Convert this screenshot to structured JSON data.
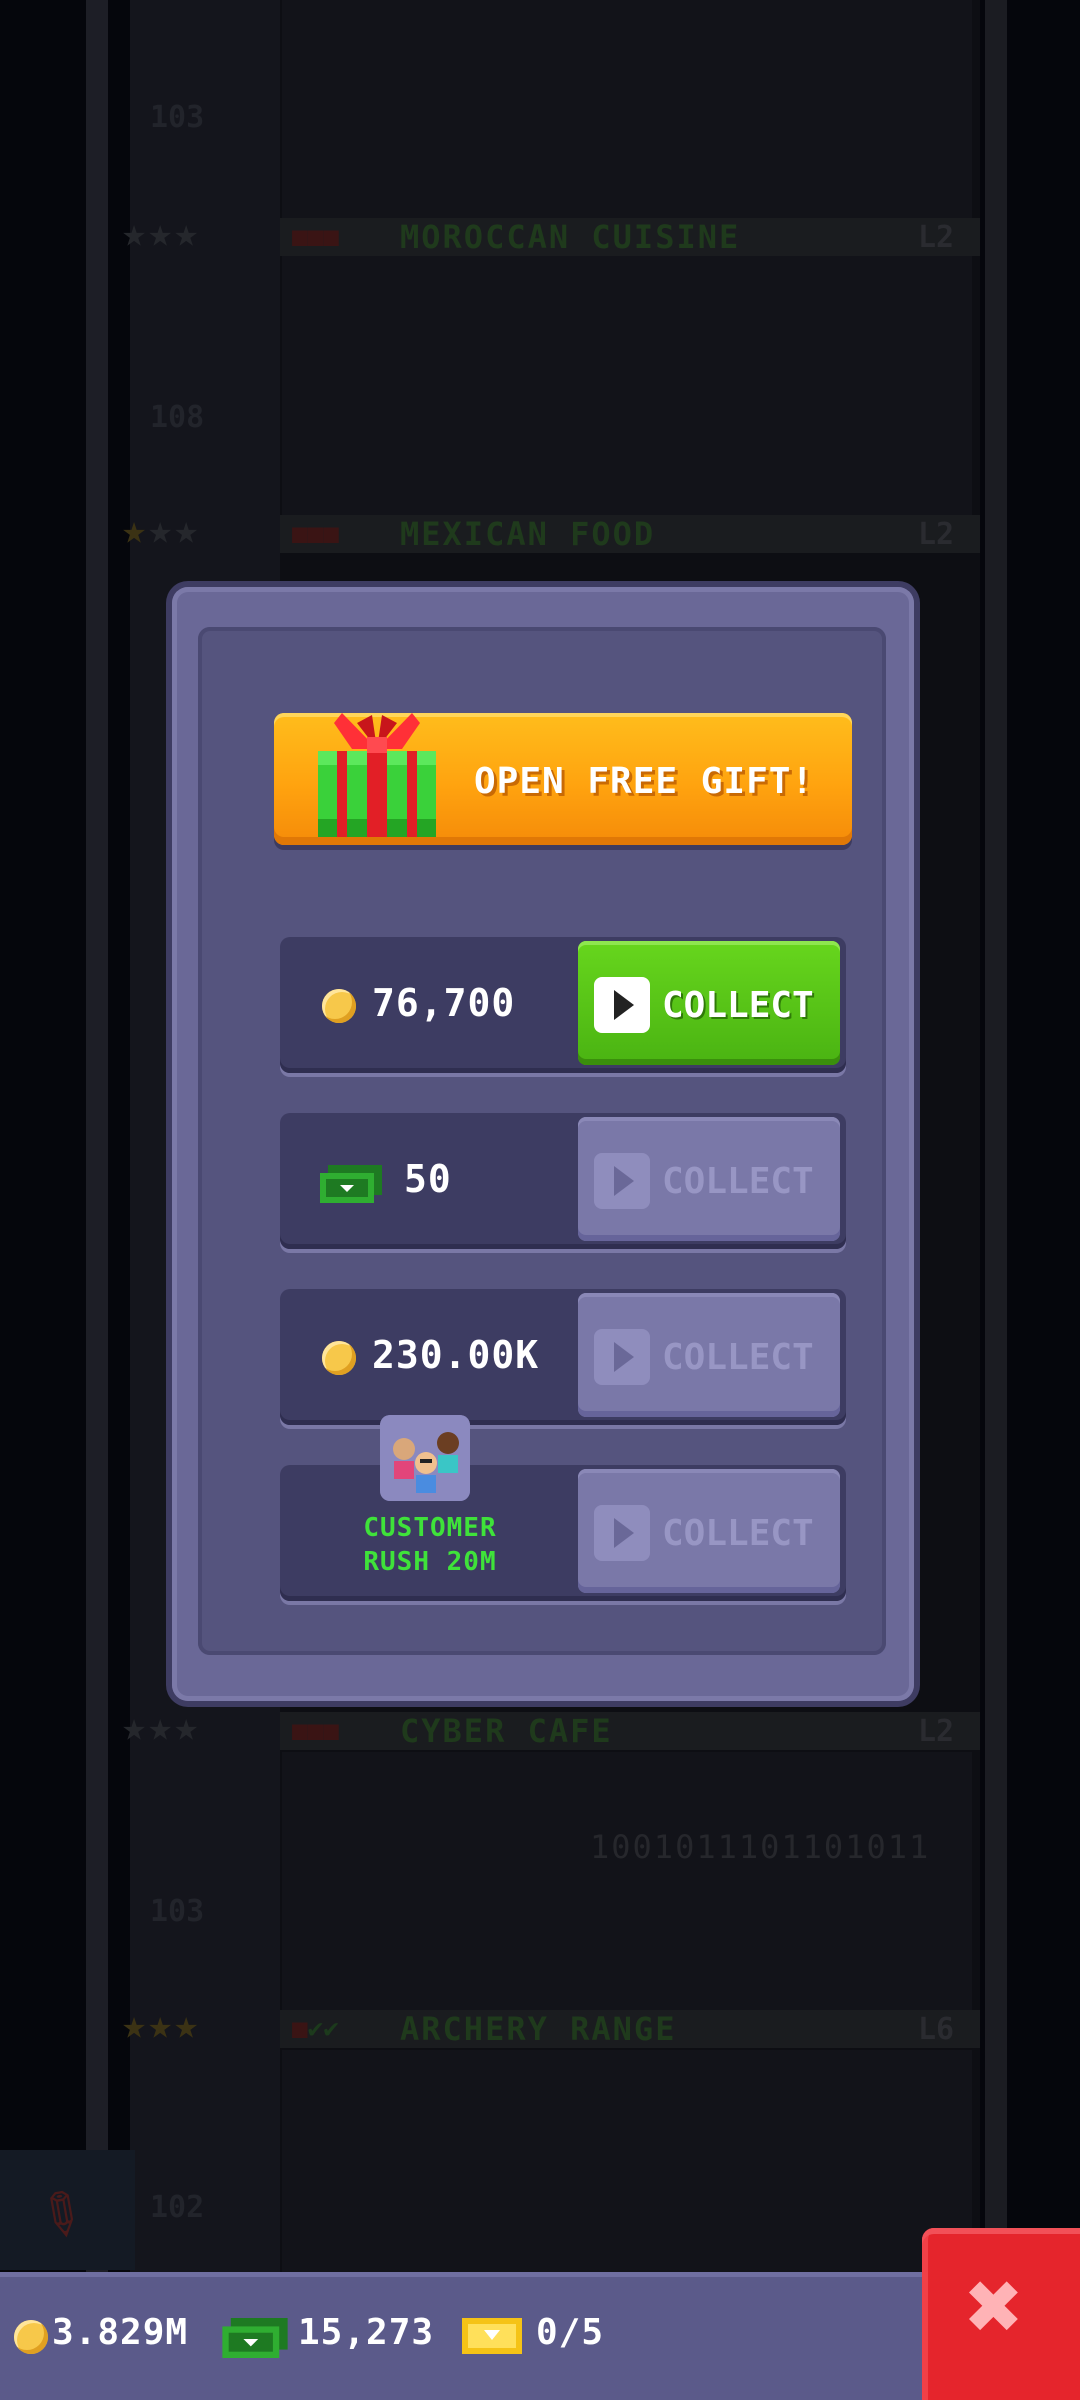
{
  "colors": {
    "dialog": "#6a6897",
    "dialog_inner": "#55547e",
    "gift_button": "#ffa30f",
    "collect_active": "#55c116",
    "collect_disabled": "#7a78a8",
    "rush_text": "#3fe23a",
    "close_button": "#e5252c"
  },
  "background": {
    "floors": [
      {
        "number": "103",
        "name": "MOROCCAN CUISINE",
        "level": "L2"
      },
      {
        "number": "108",
        "name": "MEXICAN FOOD",
        "level": "L2"
      },
      {
        "number": "",
        "name": "CYBER CAFE",
        "level": "L2"
      },
      {
        "number": "103",
        "name": "ARCHERY RANGE",
        "level": "L6"
      },
      {
        "number": "102",
        "name": "",
        "level": ""
      }
    ],
    "binary_text": "1001011101101011"
  },
  "dialog": {
    "gift_button_label": "OPEN FREE GIFT!",
    "rewards": [
      {
        "icon": "coin-icon",
        "amount": "76,700",
        "button_label": "COLLECT",
        "enabled": true
      },
      {
        "icon": "cash-icon",
        "amount": "50",
        "button_label": "COLLECT",
        "enabled": false
      },
      {
        "icon": "coin-icon",
        "amount": "230.00K",
        "button_label": "COLLECT",
        "enabled": false
      },
      {
        "icon": "customers-icon",
        "amount_line1": "CUSTOMER",
        "amount_line2": "RUSH 20M",
        "button_label": "COLLECT",
        "enabled": false
      }
    ]
  },
  "status_bar": {
    "coins": "3.829M",
    "cash": "15,273",
    "tickets": "0/5"
  },
  "close_icon": "close-icon"
}
